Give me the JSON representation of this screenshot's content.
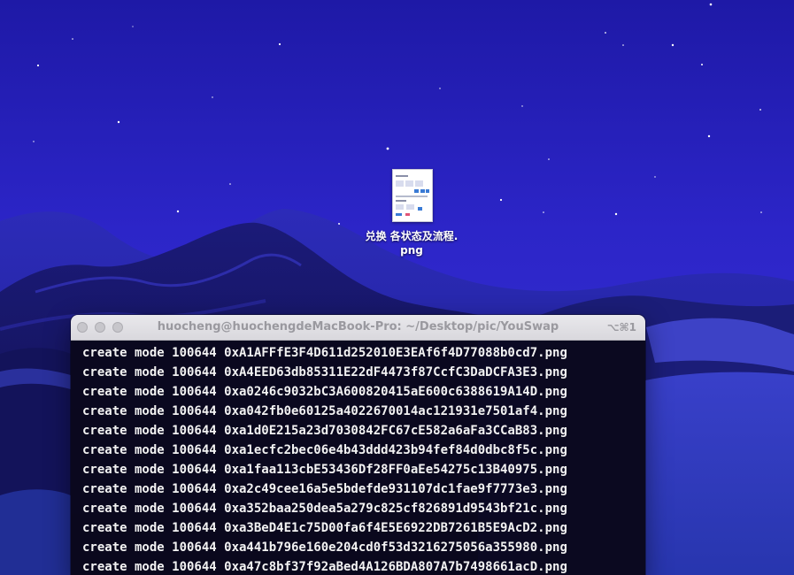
{
  "desktop": {
    "file_icon": {
      "label": "兑换 各状态及流程.png",
      "icon": "png-thumbnail-icon"
    }
  },
  "terminal": {
    "title": "huocheng@huochengdeMacBook-Pro: ~/Desktop/pic/YouSwap",
    "shortcut": "⌥⌘1",
    "controls": {
      "close": "close-icon",
      "minimize": "minimize-icon",
      "maximize": "zoom-icon"
    },
    "lines": [
      "create mode 100644 0xA1AFFfE3F4D611d252010E3EAf6f4D77088b0cd7.png",
      "create mode 100644 0xA4EED63db85311E22dF4473f87CcfC3DaDCFA3E3.png",
      "create mode 100644 0xa0246c9032bC3A600820415aE600c6388619A14D.png",
      "create mode 100644 0xa042fb0e60125a4022670014ac121931e7501af4.png",
      "create mode 100644 0xa1d0E215a23d7030842FC67cE582a6aFa3CCaB83.png",
      "create mode 100644 0xa1ecfc2bec06e4b43ddd423b94fef84d0dbc8f5c.png",
      "create mode 100644 0xa1faa113cbE53436Df28FF0aEe54275c13B40975.png",
      "create mode 100644 0xa2c49cee16a5e5bdefde931107dc1fae9f7773e3.png",
      "create mode 100644 0xa352baa250dea5a279c825cf826891d9543bf21c.png",
      "create mode 100644 0xa3BeD4E1c75D00fa6f4E5E6922DB7261B5E9AcD2.png",
      "create mode 100644 0xa441b796e160e204cd0f53d3216275056a355980.png",
      "create mode 100644 0xa47c8bf37f92aBed4A126BDA807A7b7498661acD.png"
    ]
  }
}
